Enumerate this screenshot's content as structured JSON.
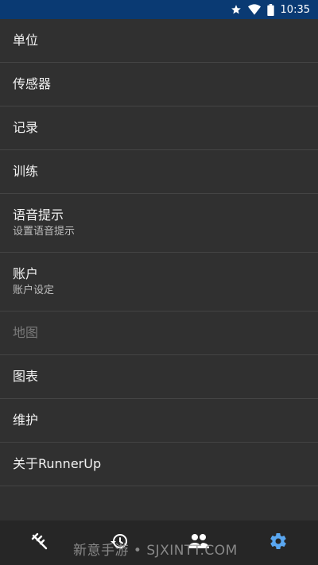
{
  "status_bar": {
    "time": "10:35",
    "icons": [
      "star-icon",
      "wifi-icon",
      "battery-icon"
    ]
  },
  "menu": {
    "items": [
      {
        "title": "单位"
      },
      {
        "title": "传感器"
      },
      {
        "title": "记录"
      },
      {
        "title": "训练"
      },
      {
        "title": "语音提示",
        "subtitle": "设置语音提示"
      },
      {
        "title": "账户",
        "subtitle": "账户设定"
      },
      {
        "title": "地图",
        "disabled": true
      },
      {
        "title": "图表"
      },
      {
        "title": "维护"
      },
      {
        "title": "关于RunnerUp"
      }
    ]
  },
  "bottom_nav": {
    "items": [
      {
        "icon": "workout-icon"
      },
      {
        "icon": "history-icon"
      },
      {
        "icon": "people-icon"
      },
      {
        "icon": "gear-icon",
        "active": true
      }
    ],
    "active_color": "#5aa7f0",
    "inactive_color": "#ffffff"
  },
  "watermark": "新意手游 • SJXINTT.COM",
  "colors": {
    "status_bar": "#0a3a73",
    "background": "#303030",
    "divider": "#444444"
  }
}
